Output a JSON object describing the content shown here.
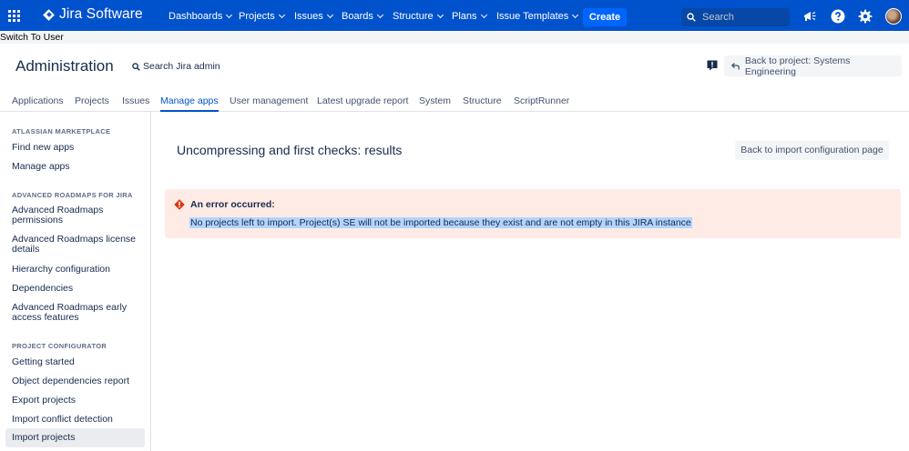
{
  "topnav": {
    "brand": "Jira Software",
    "items": [
      {
        "label": "Dashboards"
      },
      {
        "label": "Projects"
      },
      {
        "label": "Issues"
      },
      {
        "label": "Boards"
      },
      {
        "label": "Structure"
      },
      {
        "label": "Plans"
      },
      {
        "label": "Issue Templates"
      }
    ],
    "create_label": "Create",
    "search_placeholder": "Search",
    "icons": [
      "app-switcher-icon",
      "notifications-megaphone-icon",
      "help-icon",
      "settings-gear-icon",
      "user-avatar"
    ],
    "colors": {
      "bar": "#0052cc",
      "create": "#0065ff",
      "search_bg": "#0747a6"
    }
  },
  "switch_user": "Switch To User",
  "admin": {
    "title": "Administration",
    "search_label": "Search Jira admin",
    "back_to_project": "Back to project: Systems Engineering"
  },
  "tabs": [
    {
      "label": "Applications",
      "active": false
    },
    {
      "label": "Projects",
      "active": false
    },
    {
      "label": "Issues",
      "active": false
    },
    {
      "label": "Manage apps",
      "active": true
    },
    {
      "label": "User management",
      "active": false
    },
    {
      "label": "Latest upgrade report",
      "active": false
    },
    {
      "label": "System",
      "active": false
    },
    {
      "label": "Structure",
      "active": false
    },
    {
      "label": "ScriptRunner",
      "active": false
    }
  ],
  "sidebar": {
    "sections": [
      {
        "heading": "ATLASSIAN MARKETPLACE",
        "items": [
          "Find new apps",
          "Manage apps"
        ]
      },
      {
        "heading": "ADVANCED ROADMAPS FOR JIRA",
        "items": [
          "Advanced Roadmaps permissions",
          "Advanced Roadmaps license details",
          "Hierarchy configuration",
          "Dependencies",
          "Advanced Roadmaps early access features"
        ]
      },
      {
        "heading": "PROJECT CONFIGURATOR",
        "items": [
          "Getting started",
          "Object dependencies report",
          "Export projects",
          "Import conflict detection",
          "Import projects"
        ]
      }
    ],
    "active_item": "Import projects"
  },
  "main": {
    "heading": "Uncompressing and first checks: results",
    "back_button": "Back to import configuration page",
    "error": {
      "title": "An error occurred:",
      "message": "No projects left to import. Project(s) SE will not be imported because they exist and are not empty in this JIRA instance",
      "bg_color": "#ffebe6",
      "icon_color": "#de350b"
    }
  }
}
